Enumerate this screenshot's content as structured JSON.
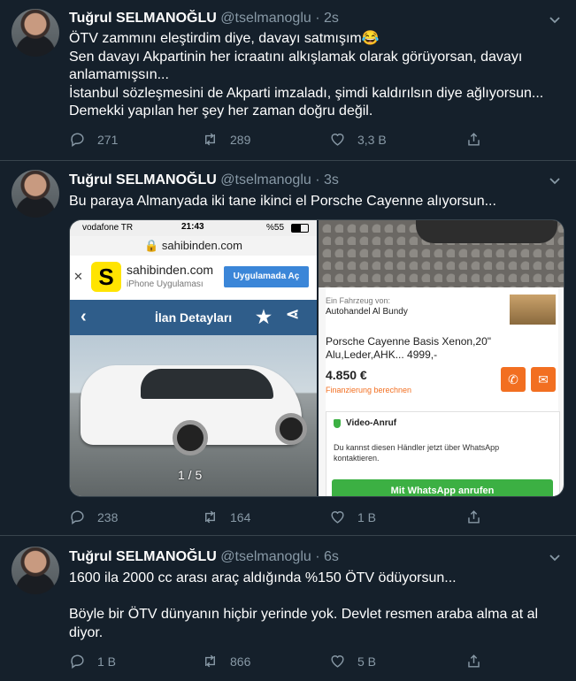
{
  "tweets": [
    {
      "name": "Tuğrul SELMANOĞLU",
      "handle": "@tselmanoglu",
      "dot": "·",
      "time": "2s",
      "lines": [
        "ÖTV zammını eleştirdim diye, davayı  satmışım😂",
        "Sen davayı Akpartinin her icraatını alkışlamak olarak görüyorsan, davayı anlamamışsın...",
        "İstanbul sözleşmesini de Akparti imzaladı, şimdi kaldırılsın diye ağlıyorsun...",
        "Demekki yapılan her şey her zaman doğru değil."
      ],
      "replies": "271",
      "retweets": "289",
      "likes": "3,3 B"
    },
    {
      "name": "Tuğrul SELMANOĞLU",
      "handle": "@tselmanoglu",
      "dot": "·",
      "time": "3s",
      "lines": [
        "Bu paraya Almanyada iki tane ikinci el Porsche Cayenne alıyorsun..."
      ],
      "replies": "238",
      "retweets": "164",
      "likes": "1 B",
      "media": {
        "left": {
          "carrier": "vodafone TR",
          "clock": "21:43",
          "battery": "%55",
          "url": "sahibinden.com",
          "app_name": "sahibinden.com",
          "app_sub": "iPhone Uygulaması",
          "app_button": "Uygulamada Aç",
          "app_logo": "S",
          "close": "✕",
          "detail_title": "İlan Detayları",
          "counter": "1 / 5"
        },
        "right": {
          "seller_label": "Ein Fahrzeug von:",
          "seller": "Autohandel Al Bundy",
          "title_l1": "Porsche Cayenne Basis Xenon,20\"",
          "title_l2": "Alu,Leder,AHK... 4999,-",
          "price": "4.850 €",
          "financing": "Finanzierung berechnen",
          "video_title": "Video-Anruf",
          "video_text": "Du kannst diesen Händler jetzt über WhatsApp kontaktieren.",
          "whatsapp": "Mit WhatsApp anrufen"
        }
      }
    },
    {
      "name": "Tuğrul SELMANOĞLU",
      "handle": "@tselmanoglu",
      "dot": "·",
      "time": "6s",
      "lines": [
        "1600 ila 2000 cc arası araç aldığında %150 ÖTV ödüyorsun...",
        "",
        "Böyle bir ÖTV dünyanın hiçbir yerinde yok. Devlet resmen araba alma at al diyor."
      ],
      "replies": "1 B",
      "retweets": "866",
      "likes": "5 B"
    }
  ],
  "colors": {
    "background": "#15202b",
    "secondary_text": "#8899a6",
    "divider": "#38444d"
  }
}
